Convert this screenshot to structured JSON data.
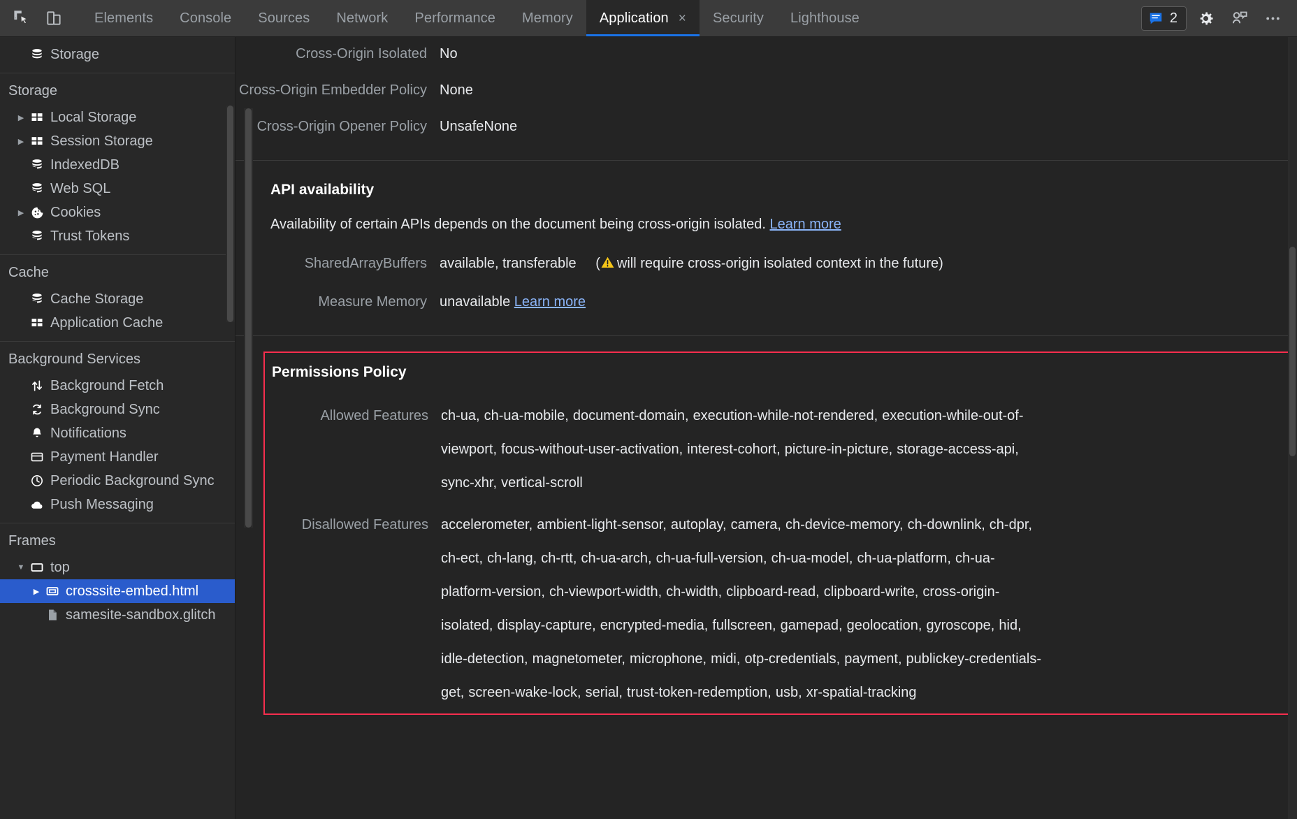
{
  "toolbar": {
    "inspect_icon": "inspect-element-icon",
    "device_icon": "device-toolbar-icon",
    "tabs": [
      {
        "label": "Elements",
        "active": false
      },
      {
        "label": "Console",
        "active": false
      },
      {
        "label": "Sources",
        "active": false
      },
      {
        "label": "Network",
        "active": false
      },
      {
        "label": "Performance",
        "active": false
      },
      {
        "label": "Memory",
        "active": false
      },
      {
        "label": "Application",
        "active": true
      },
      {
        "label": "Security",
        "active": false
      },
      {
        "label": "Lighthouse",
        "active": false
      }
    ],
    "active_tab_close": "×",
    "message_count": "2",
    "message_icon": "console-message-icon",
    "settings_icon": "gear-icon",
    "collab_icon": "devices-collab-icon",
    "more_icon": "more-options-icon",
    "accent_color": "#1a73e8"
  },
  "sidebar": {
    "top_partial_item": {
      "label": "Storage",
      "icon": "database-icon"
    },
    "sections": [
      {
        "header": "Storage",
        "items": [
          {
            "label": "Local Storage",
            "icon": "table-icon",
            "twisty": "▶"
          },
          {
            "label": "Session Storage",
            "icon": "table-icon",
            "twisty": "▶"
          },
          {
            "label": "IndexedDB",
            "icon": "database-icon",
            "twisty": ""
          },
          {
            "label": "Web SQL",
            "icon": "database-icon",
            "twisty": ""
          },
          {
            "label": "Cookies",
            "icon": "cookie-icon",
            "twisty": "▶"
          },
          {
            "label": "Trust Tokens",
            "icon": "database-icon",
            "twisty": ""
          }
        ]
      },
      {
        "header": "Cache",
        "items": [
          {
            "label": "Cache Storage",
            "icon": "database-icon",
            "twisty": ""
          },
          {
            "label": "Application Cache",
            "icon": "table-icon",
            "twisty": ""
          }
        ]
      },
      {
        "header": "Background Services",
        "items": [
          {
            "label": "Background Fetch",
            "icon": "arrows-updown-icon",
            "twisty": ""
          },
          {
            "label": "Background Sync",
            "icon": "sync-icon",
            "twisty": ""
          },
          {
            "label": "Notifications",
            "icon": "bell-icon",
            "twisty": ""
          },
          {
            "label": "Payment Handler",
            "icon": "credit-card-icon",
            "twisty": ""
          },
          {
            "label": "Periodic Background Sync",
            "icon": "clock-icon",
            "twisty": ""
          },
          {
            "label": "Push Messaging",
            "icon": "cloud-icon",
            "twisty": ""
          }
        ]
      },
      {
        "header": "Frames",
        "items": [
          {
            "label": "top",
            "icon": "frame-icon",
            "twisty": "▼",
            "depth": 1,
            "selected": false
          },
          {
            "label": "crosssite-embed.html",
            "icon": "iframe-icon",
            "twisty": "▶",
            "depth": 2,
            "selected": true
          },
          {
            "label": "samesite-sandbox.glitch",
            "icon": "document-icon",
            "twisty": "",
            "depth": 2,
            "selected": false
          }
        ]
      }
    ],
    "selected_color": "#2a5ccc"
  },
  "main": {
    "security_rows": [
      {
        "key": "Cross-Origin Isolated",
        "value": "No"
      },
      {
        "key": "Cross-Origin Embedder Policy",
        "value": "None"
      },
      {
        "key": "Cross-Origin Opener Policy",
        "value": "UnsafeNone"
      }
    ],
    "api_availability": {
      "title": "API availability",
      "description": "Availability of certain APIs depends on the document being cross-origin isolated.",
      "description_link": "Learn more",
      "rows": [
        {
          "key": "SharedArrayBuffers",
          "value": "available, transferable",
          "note_prefix": "(",
          "warn_icon": "warning-triangle-icon",
          "note": "will require cross-origin isolated context in the future)",
          "link": ""
        },
        {
          "key": "Measure Memory",
          "value": "unavailable",
          "note_prefix": "",
          "warn_icon": "",
          "note": "",
          "link": "Learn more"
        }
      ]
    },
    "permissions_policy": {
      "title": "Permissions Policy",
      "border_color": "#f62e4e",
      "rows": [
        {
          "key": "Allowed Features",
          "value": "ch-ua, ch-ua-mobile, document-domain, execution-while-not-rendered, execution-while-out-of-viewport, focus-without-user-activation, interest-cohort, picture-in-picture, storage-access-api, sync-xhr, vertical-scroll"
        },
        {
          "key": "Disallowed Features",
          "value": "accelerometer, ambient-light-sensor, autoplay, camera, ch-device-memory, ch-downlink, ch-dpr, ch-ect, ch-lang, ch-rtt, ch-ua-arch, ch-ua-full-version, ch-ua-model, ch-ua-platform, ch-ua-platform-version, ch-viewport-width, ch-width, clipboard-read, clipboard-write, cross-origin-isolated, display-capture, encrypted-media, fullscreen, gamepad, geolocation, gyroscope, hid, idle-detection, magnetometer, microphone, midi, otp-credentials, payment, publickey-credentials-get, screen-wake-lock, serial, trust-token-redemption, usb, xr-spatial-tracking"
        }
      ]
    }
  }
}
